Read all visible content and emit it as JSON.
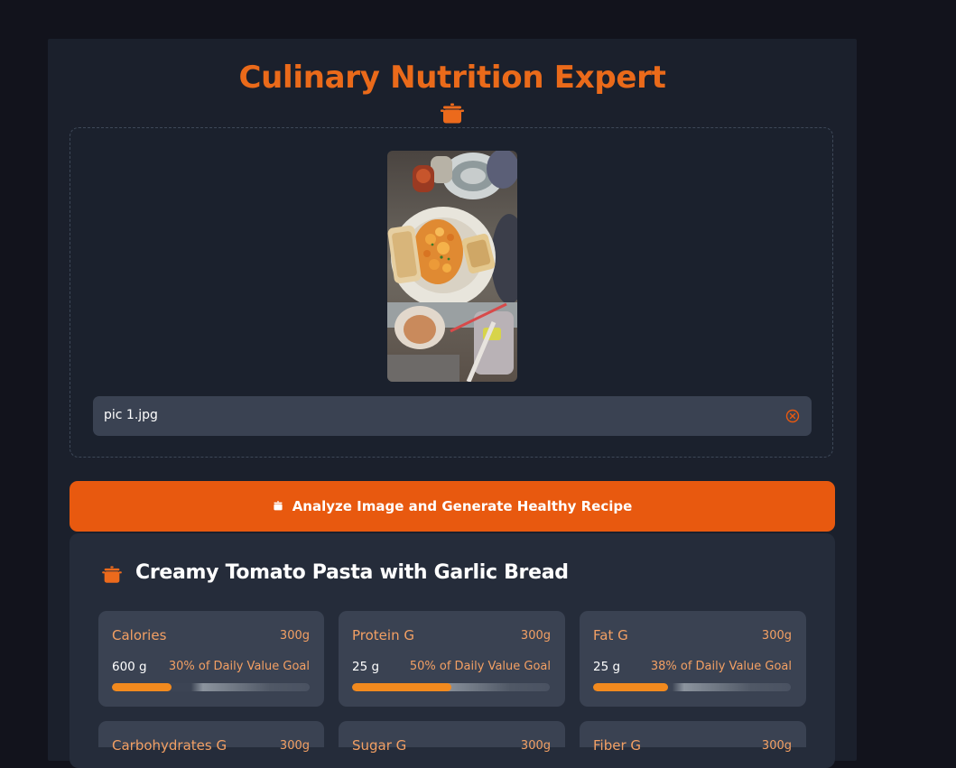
{
  "app": {
    "title": "Culinary Nutrition Expert",
    "title_icon": "cooking-pot-icon",
    "accent_color": "#ea6a1a"
  },
  "upload": {
    "image_description_icon": "food-photo",
    "file_name": "pic 1.jpg",
    "remove_icon": "close-circle-icon"
  },
  "actions": {
    "analyze_label": "Analyze Image and Generate Healthy Recipe",
    "analyze_icon": "cooking-pot-icon",
    "button_color": "#e8590f"
  },
  "recipe": {
    "title": "Creamy Tomato Pasta with Garlic Bread",
    "icon": "cooking-pot-icon",
    "nutrients": [
      {
        "name": "Calories",
        "serving": "300g",
        "amount": "600 g",
        "goal": "30% of Daily Value Goal",
        "percent": 30
      },
      {
        "name": "Protein G",
        "serving": "300g",
        "amount": "25 g",
        "goal": "50% of Daily Value Goal",
        "percent": 50
      },
      {
        "name": "Fat G",
        "serving": "300g",
        "amount": "25 g",
        "goal": "38% of Daily Value Goal",
        "percent": 38
      },
      {
        "name": "Carbohydrates G",
        "serving": "300g"
      },
      {
        "name": "Sugar G",
        "serving": "300g"
      },
      {
        "name": "Fiber G",
        "serving": "300g"
      }
    ]
  }
}
